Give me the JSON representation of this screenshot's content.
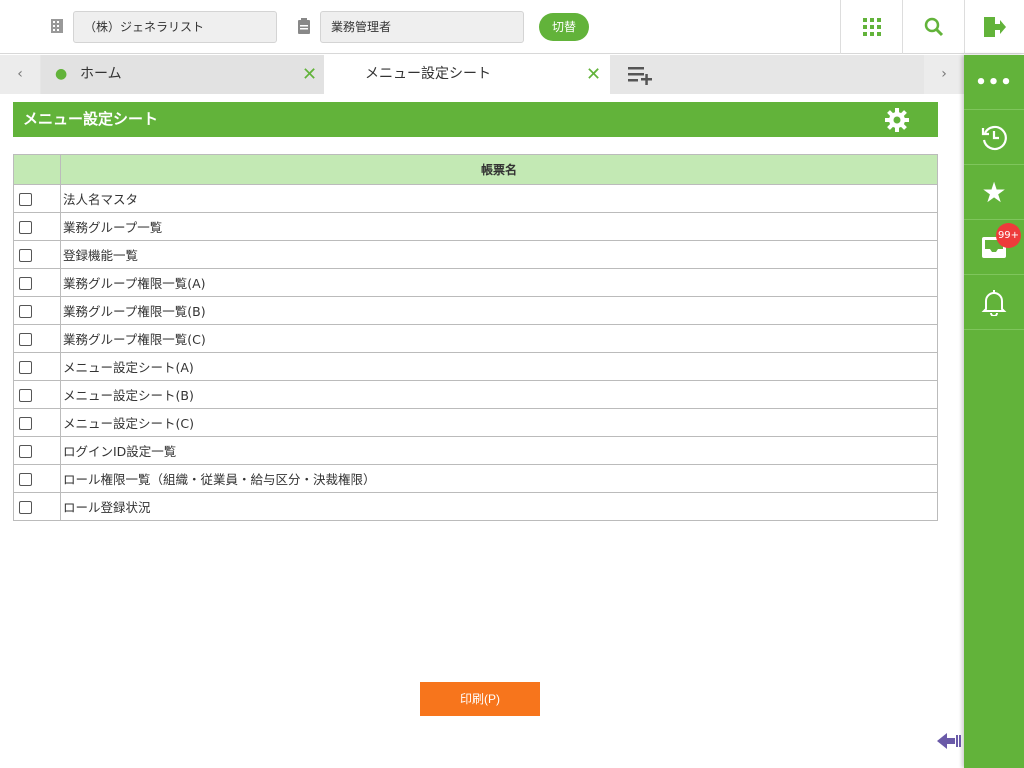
{
  "header": {
    "company": "（株）ジェネラリスト",
    "role": "業務管理者",
    "switch_label": "切替"
  },
  "tabs": [
    {
      "label": "ホーム"
    },
    {
      "label": "メニュー設定シート",
      "active": true
    }
  ],
  "sidebar": {
    "badge": "99+"
  },
  "page": {
    "title": "メニュー設定シート",
    "column_header": "帳票名",
    "rows": [
      "法人名マスタ",
      "業務グループ一覧",
      "登録機能一覧",
      "業務グループ権限一覧(A)",
      "業務グループ権限一覧(B)",
      "業務グループ権限一覧(C)",
      "メニュー設定シート(A)",
      "メニュー設定シート(B)",
      "メニュー設定シート(C)",
      "ログインID設定一覧",
      "ロール権限一覧（組織・従業員・給与区分・決裁権限）",
      "ロール登録状況"
    ],
    "print_label": "印刷(P)"
  },
  "colors": {
    "accent": "#62b33a",
    "print": "#f7751c",
    "header_row": "#c3e9b4",
    "badge": "#ee3b3b"
  }
}
